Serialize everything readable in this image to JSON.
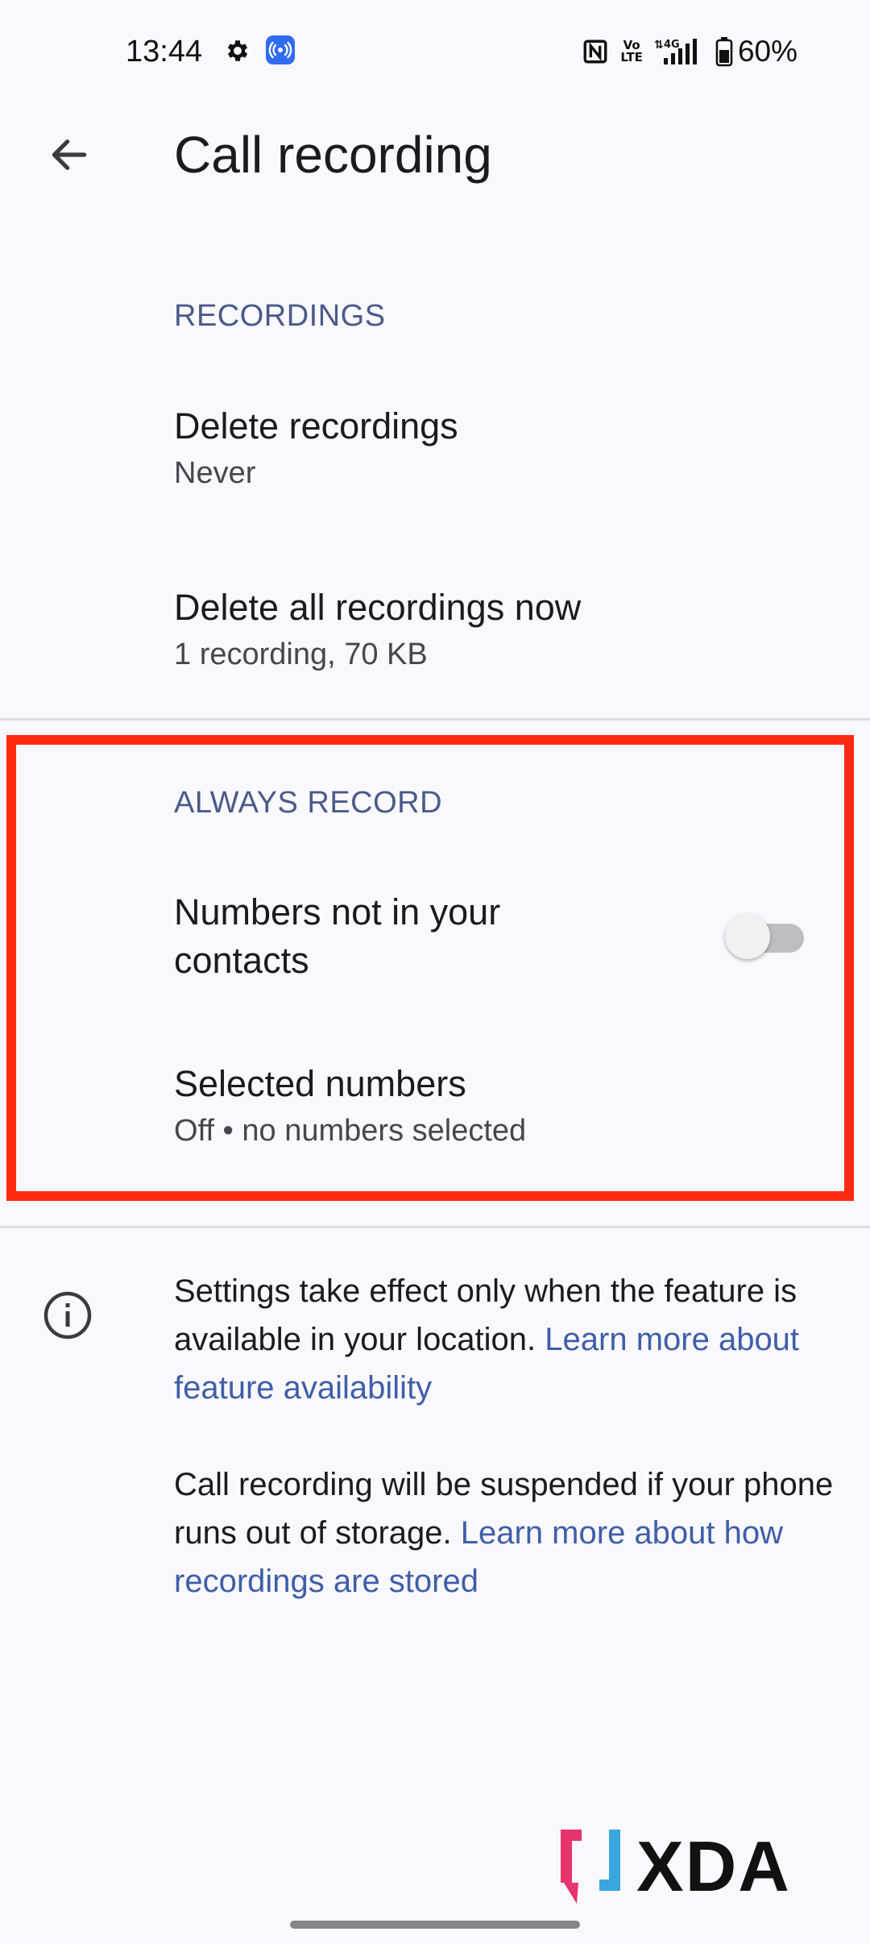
{
  "status_bar": {
    "time": "13:44",
    "battery": "60%",
    "network_label": "4G",
    "volte_label": "Vo LTE",
    "icons": [
      "gear-icon",
      "hotspot-icon",
      "nfc-icon",
      "volte-icon",
      "signal-icon",
      "battery-icon"
    ]
  },
  "app_bar": {
    "title": "Call recording",
    "back_icon": "arrow-left-icon"
  },
  "recordings_section": {
    "header": "RECORDINGS",
    "items": [
      {
        "title": "Delete recordings",
        "subtitle": "Never"
      },
      {
        "title": "Delete all recordings now",
        "subtitle": "1 recording, 70 KB"
      }
    ]
  },
  "always_record_section": {
    "header": "ALWAYS RECORD",
    "unknown_numbers": {
      "title_line1": "Numbers not in your",
      "title_line2": "contacts",
      "toggle_on": false
    },
    "selected_numbers": {
      "title": "Selected numbers",
      "subtitle": "Off • no numbers selected"
    }
  },
  "info": {
    "icon": "info-icon",
    "para1_text": "Settings take effect only when the feature is available in your location. ",
    "para1_link": "Learn more about feature availability",
    "para2_text": "Call recording will be suspended if your phone runs out of storage. ",
    "para2_link": "Learn more about how recordings are stored"
  },
  "watermark": {
    "text": "XDA"
  },
  "colors": {
    "background": "#f9f8fc",
    "section_header": "#4a5a8a",
    "link": "#3f5ea8",
    "highlight": "#ff2a12",
    "hotspot_badge": "#2f6cf0",
    "xda_pink": "#e8336d",
    "xda_blue": "#3aa6e0"
  }
}
